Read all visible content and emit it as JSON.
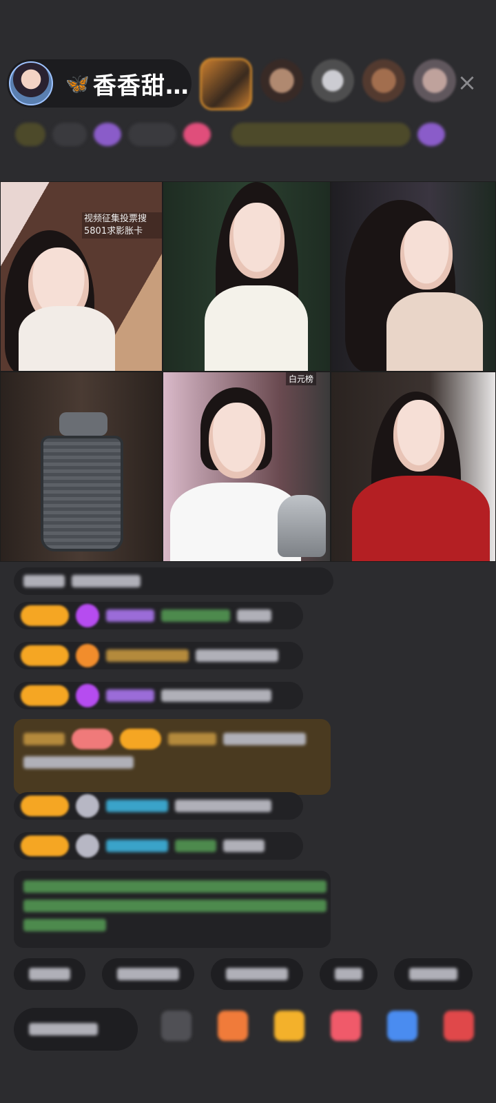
{
  "header": {
    "host_name": "香香甜…",
    "butterfly_icon": "🦋",
    "close_icon": "×"
  },
  "video_grid": {
    "tile1_note": "视频征集投票搜5801求影胀卡",
    "tile5_tag": "白元榜"
  },
  "icons": {
    "close": "close-icon",
    "butterfly": "butterfly-icon",
    "gift": "gift-icon",
    "emoji": "emoji-icon"
  },
  "colors": {
    "background": "#2c2c2f",
    "badge": "#f5a623",
    "accent_blue": "#4ab4ff"
  }
}
